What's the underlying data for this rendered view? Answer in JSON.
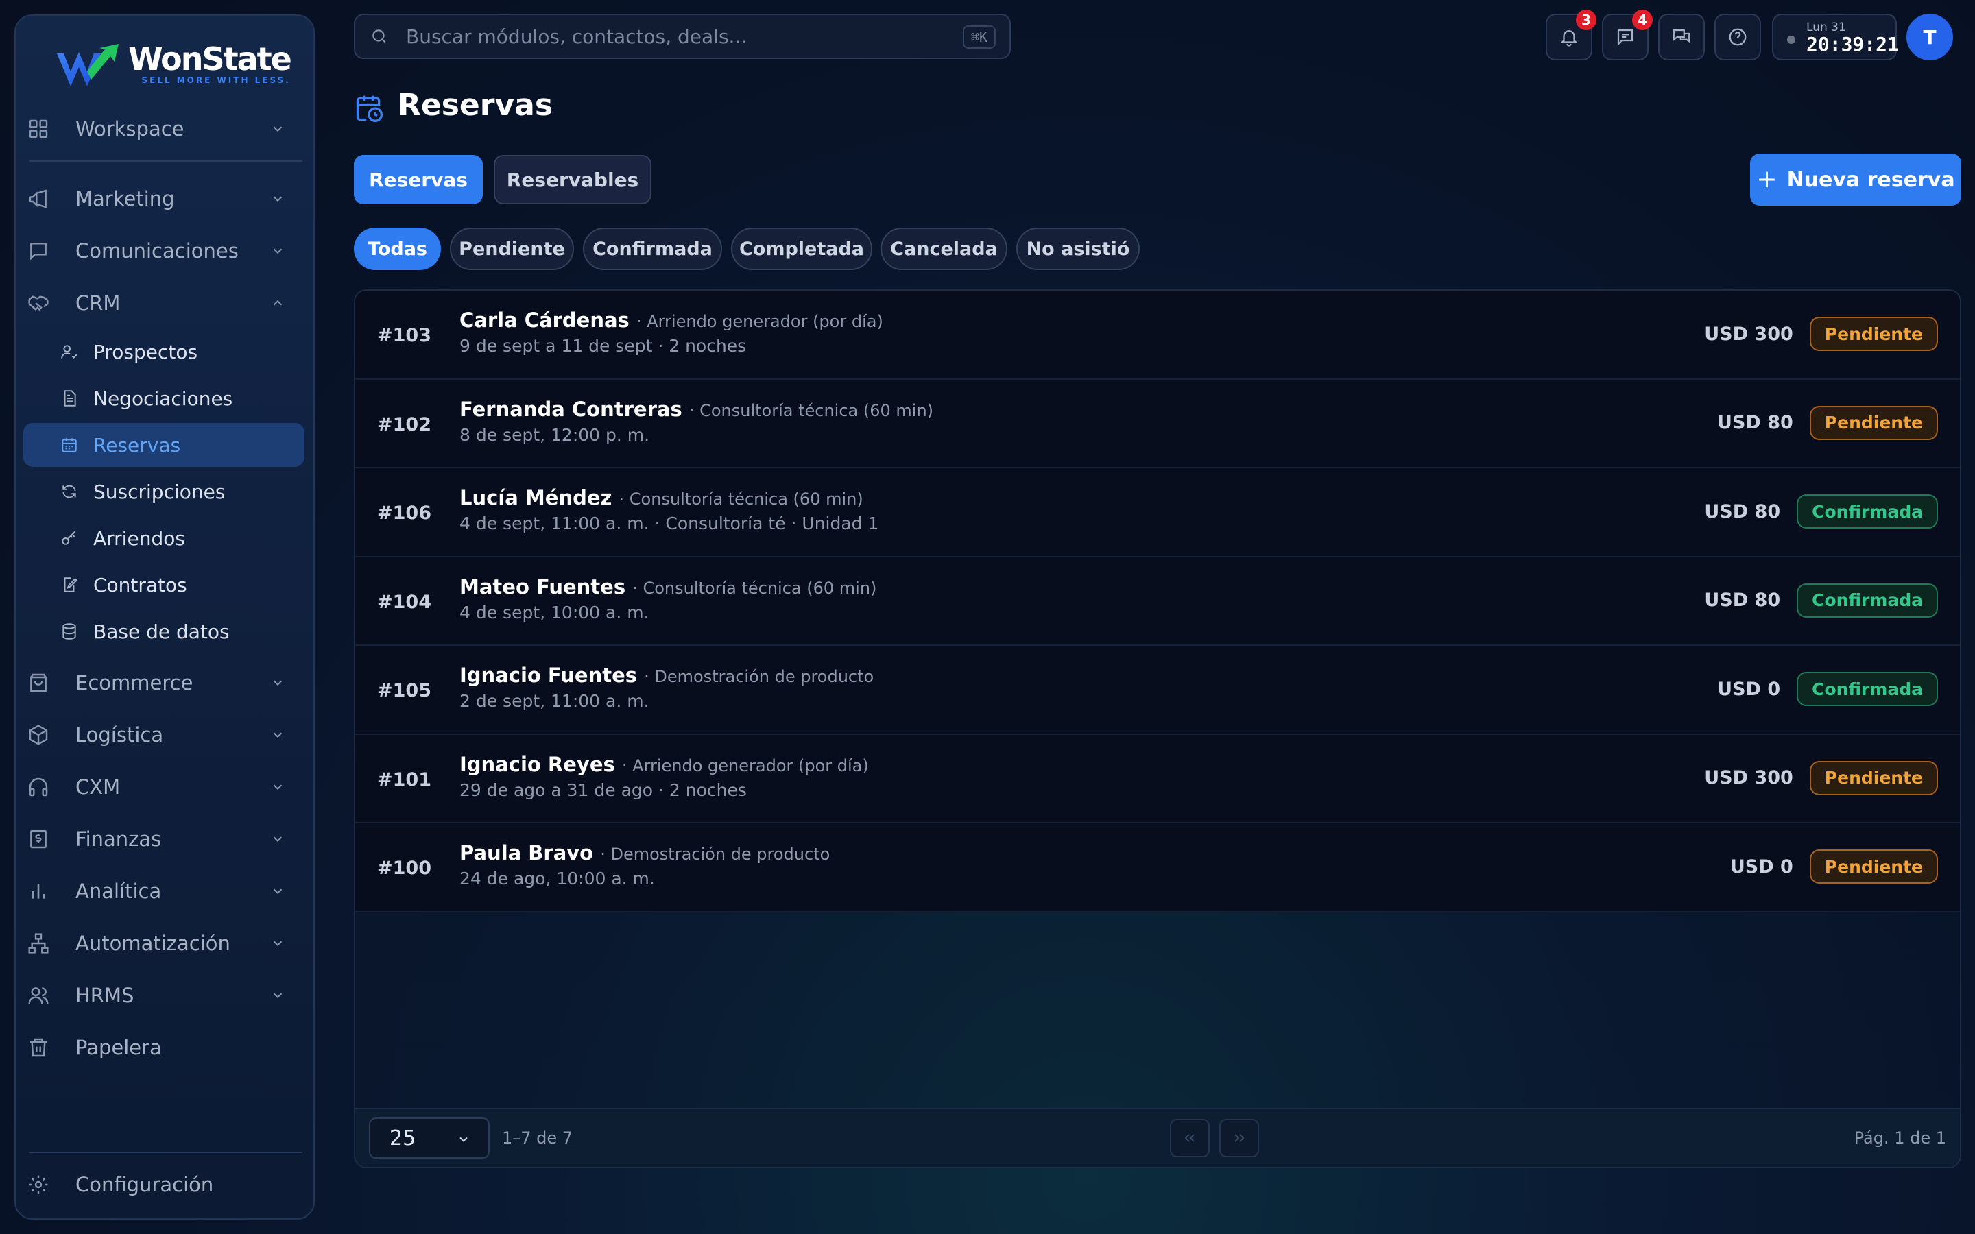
{
  "brand": {
    "name": "WonState",
    "tagline": "SELL MORE WITH LESS."
  },
  "sidebar": {
    "groups": [
      {
        "label": "Workspace",
        "icon": "grid-icon"
      },
      {
        "label": "Marketing",
        "icon": "megaphone-icon"
      },
      {
        "label": "Comunicaciones",
        "icon": "chat-icon"
      },
      {
        "label": "CRM",
        "icon": "handshake-icon",
        "expanded": true
      }
    ],
    "crm_items": [
      {
        "label": "Prospectos",
        "icon": "user-icon"
      },
      {
        "label": "Negociaciones",
        "icon": "document-icon"
      },
      {
        "label": "Reservas",
        "icon": "calendar-icon",
        "active": true
      },
      {
        "label": "Suscripciones",
        "icon": "refresh-icon"
      },
      {
        "label": "Arriendos",
        "icon": "key-icon"
      },
      {
        "label": "Contratos",
        "icon": "signature-icon"
      },
      {
        "label": "Base de datos",
        "icon": "database-icon"
      }
    ],
    "more_groups": [
      {
        "label": "Ecommerce",
        "icon": "shopping-bag-icon"
      },
      {
        "label": "Logística",
        "icon": "box-icon"
      },
      {
        "label": "CXM",
        "icon": "headphones-icon"
      },
      {
        "label": "Finanzas",
        "icon": "finance-icon"
      },
      {
        "label": "Analítica",
        "icon": "bar-chart-icon"
      },
      {
        "label": "Automatización",
        "icon": "workflow-icon"
      },
      {
        "label": "HRMS",
        "icon": "users-icon"
      },
      {
        "label": "Papelera",
        "icon": "trash-icon"
      }
    ],
    "settings_label": "Configuración"
  },
  "topbar": {
    "search_placeholder": "Buscar módulos, contactos, deals...",
    "search_shortcut": "⌘K",
    "notifications_count": "3",
    "messages_count": "4",
    "clock_day": "Lun 31",
    "clock_time": "20:39:21",
    "avatar_initial": "T"
  },
  "page": {
    "title": "Reservas",
    "tabs": [
      "Reservas",
      "Reservables"
    ],
    "new_button": "Nueva reserva",
    "filters": [
      "Todas",
      "Pendiente",
      "Confirmada",
      "Completada",
      "Cancelada",
      "No asistió"
    ]
  },
  "reservations": [
    {
      "id": "#103",
      "name": "Carla Cárdenas",
      "service": "· Arriendo generador (por día)",
      "detail": "9 de sept a 11 de sept · 2 noches",
      "amount": "USD 300",
      "status": "Pendiente"
    },
    {
      "id": "#102",
      "name": "Fernanda Contreras",
      "service": "· Consultoría técnica (60 min)",
      "detail": "8 de sept, 12:00 p. m.",
      "amount": "USD 80",
      "status": "Pendiente"
    },
    {
      "id": "#106",
      "name": "Lucía Méndez",
      "service": "· Consultoría técnica (60 min)",
      "detail": "4 de sept, 11:00 a. m. · Consultoría té · Unidad 1",
      "amount": "USD 80",
      "status": "Confirmada"
    },
    {
      "id": "#104",
      "name": "Mateo Fuentes",
      "service": "· Consultoría técnica (60 min)",
      "detail": "4 de sept, 10:00 a. m.",
      "amount": "USD 80",
      "status": "Confirmada"
    },
    {
      "id": "#105",
      "name": "Ignacio Fuentes",
      "service": "· Demostración de producto",
      "detail": "2 de sept, 11:00 a. m.",
      "amount": "USD 0",
      "status": "Confirmada"
    },
    {
      "id": "#101",
      "name": "Ignacio Reyes",
      "service": "· Arriendo generador (por día)",
      "detail": "29 de ago a 31 de ago · 2 noches",
      "amount": "USD 300",
      "status": "Pendiente"
    },
    {
      "id": "#100",
      "name": "Paula Bravo",
      "service": "· Demostración de producto",
      "detail": "24 de ago, 10:00 a. m.",
      "amount": "USD 0",
      "status": "Pendiente"
    }
  ],
  "pagination": {
    "per_page": "25",
    "range": "1–7 de 7",
    "page_info": "Pág. 1 de 1"
  },
  "colors": {
    "accent": "#2f7cf0",
    "pending": "#f0a43a",
    "confirmed": "#34c78c",
    "badge": "#e11d2a"
  }
}
